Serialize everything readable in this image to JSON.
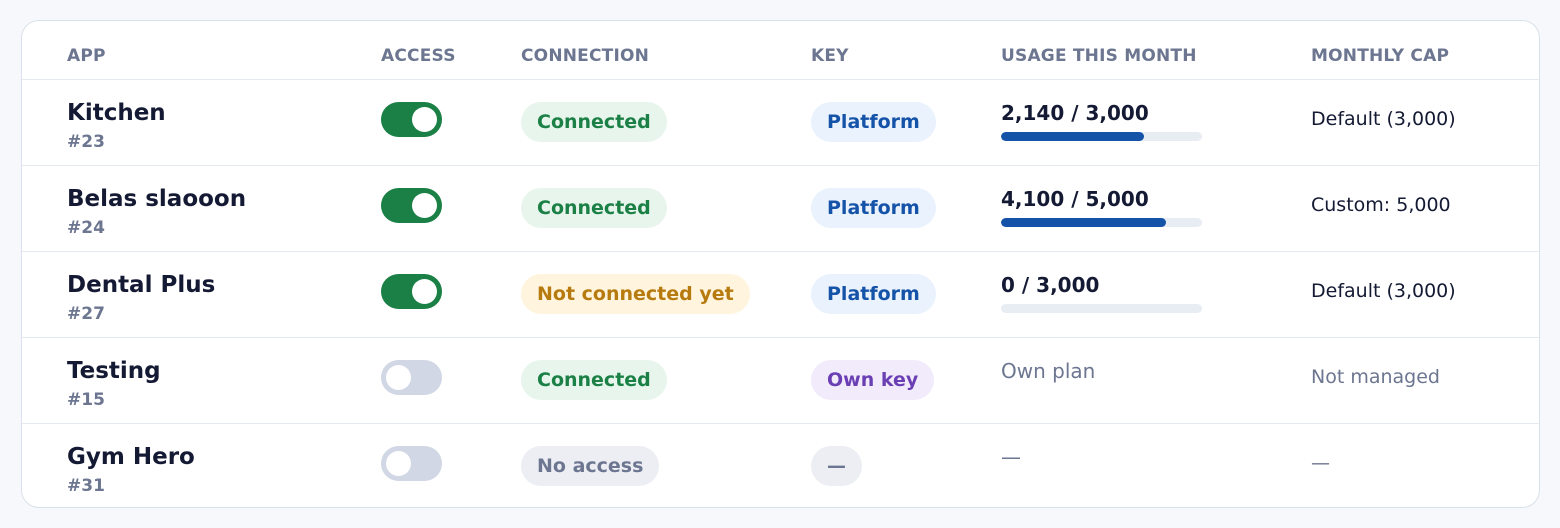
{
  "columns": {
    "app": "APP",
    "access": "ACCESS",
    "connection": "CONNECTION",
    "key": "KEY",
    "usage": "USAGE THIS MONTH",
    "cap": "MONTHLY CAP"
  },
  "colors": {
    "toggle_on": "#1b8045",
    "toggle_off": "#d1d7e4",
    "usage_bar": "#1553a9",
    "connected": "#1b8045",
    "not_connected": "#b77a0e",
    "platform": "#1553a9",
    "own_key": "#6b3fb4"
  },
  "rows": [
    {
      "name": "Kitchen",
      "id": "#23",
      "access_enabled": true,
      "connection": "Connected",
      "key": "Platform",
      "usage_text": "2,140 / 3,000",
      "usage_fraction": 0.713,
      "cap": "Default (3,000)"
    },
    {
      "name": "Belas slaooon",
      "id": "#24",
      "access_enabled": true,
      "connection": "Connected",
      "key": "Platform",
      "usage_text": "4,100 / 5,000",
      "usage_fraction": 0.82,
      "cap": "Custom: 5,000"
    },
    {
      "name": "Dental Plus",
      "id": "#27",
      "access_enabled": true,
      "connection": "Not connected yet",
      "key": "Platform",
      "usage_text": "0 / 3,000",
      "usage_fraction": 0,
      "cap": "Default (3,000)"
    },
    {
      "name": "Testing",
      "id": "#15",
      "access_enabled": false,
      "connection": "Connected",
      "key": "Own key",
      "usage_text": "Own plan",
      "cap": "Not managed"
    },
    {
      "name": "Gym Hero",
      "id": "#31",
      "access_enabled": false,
      "connection": "No access",
      "key": "—",
      "usage_text": "—",
      "cap": "—"
    }
  ]
}
